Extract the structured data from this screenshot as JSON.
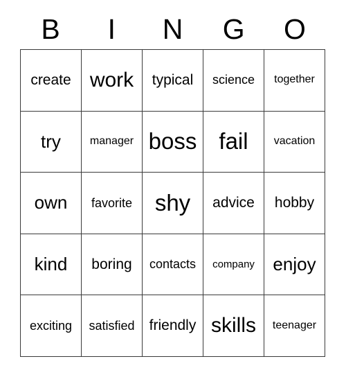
{
  "card": {
    "headers": [
      "B",
      "I",
      "N",
      "G",
      "O"
    ],
    "rows": [
      [
        {
          "word": "create",
          "size": "s-sm"
        },
        {
          "word": "work",
          "size": "s-lg"
        },
        {
          "word": "typical",
          "size": "s-sm"
        },
        {
          "word": "science",
          "size": "s-xs"
        },
        {
          "word": "together",
          "size": "s-xxs"
        }
      ],
      [
        {
          "word": "try",
          "size": "s-md"
        },
        {
          "word": "manager",
          "size": "s-xxs"
        },
        {
          "word": "boss",
          "size": "s-xl"
        },
        {
          "word": "fail",
          "size": "s-xl"
        },
        {
          "word": "vacation",
          "size": "s-xxs"
        }
      ],
      [
        {
          "word": "own",
          "size": "s-md"
        },
        {
          "word": "favorite",
          "size": "s-xs"
        },
        {
          "word": "shy",
          "size": "s-xl"
        },
        {
          "word": "advice",
          "size": "s-sm"
        },
        {
          "word": "hobby",
          "size": "s-sm"
        }
      ],
      [
        {
          "word": "kind",
          "size": "s-md"
        },
        {
          "word": "boring",
          "size": "s-sm"
        },
        {
          "word": "contacts",
          "size": "s-xs"
        },
        {
          "word": "company",
          "size": "s-tiny"
        },
        {
          "word": "enjoy",
          "size": "s-md"
        }
      ],
      [
        {
          "word": "exciting",
          "size": "s-xs"
        },
        {
          "word": "satisfied",
          "size": "s-xs"
        },
        {
          "word": "friendly",
          "size": "s-sm"
        },
        {
          "word": "skills",
          "size": "s-lg"
        },
        {
          "word": "teenager",
          "size": "s-xxs"
        }
      ]
    ]
  }
}
